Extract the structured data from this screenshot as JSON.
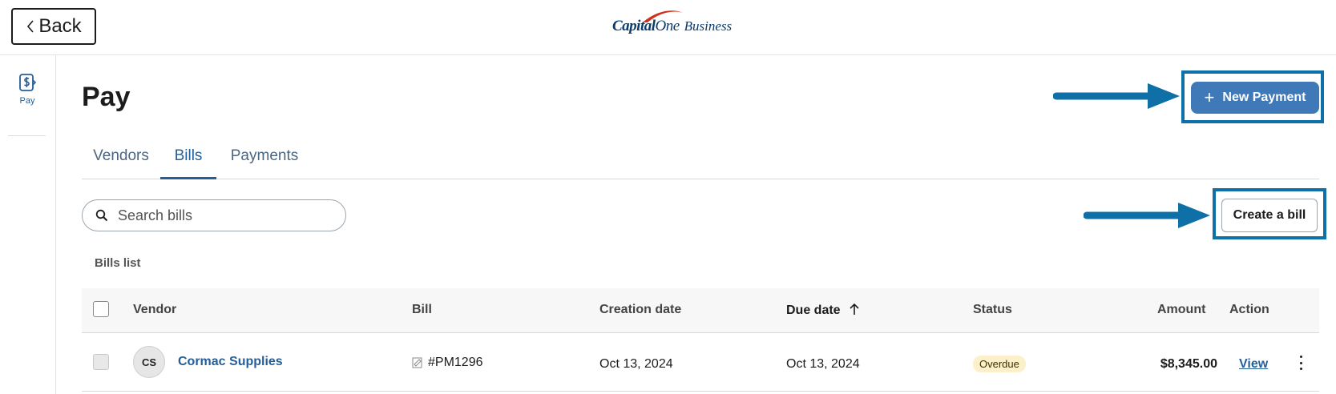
{
  "header": {
    "back_label": "Back",
    "brand_capital": "Capital",
    "brand_one": "One",
    "brand_business": "Business",
    "brand_color": "#0b3b6b",
    "swoosh_color": "#d22e1e"
  },
  "sidenav": {
    "items": [
      {
        "label": "Pay",
        "icon": "dollar-document-icon"
      }
    ]
  },
  "page": {
    "title": "Pay",
    "new_payment_label": "New Payment",
    "create_bill_label": "Create a bill",
    "accent_color": "#255f99",
    "annotation_color": "#0f70a8"
  },
  "tabs": [
    {
      "label": "Vendors",
      "active": false
    },
    {
      "label": "Bills",
      "active": true
    },
    {
      "label": "Payments",
      "active": false
    }
  ],
  "search": {
    "placeholder": "Search bills",
    "value": ""
  },
  "bills": {
    "list_label": "Bills list",
    "columns": {
      "vendor": "Vendor",
      "bill": "Bill",
      "creation_date": "Creation date",
      "due_date": "Due date",
      "status": "Status",
      "amount": "Amount",
      "action": "Action"
    },
    "sorted_column": "due_date",
    "sort_direction": "ascending",
    "rows": [
      {
        "initials": "CS",
        "vendor": "Cormac Supplies",
        "bill": "#PM1296",
        "creation_date": "Oct 13, 2024",
        "due_date": "Oct 13, 2024",
        "status": "Overdue",
        "amount": "$8,345.00",
        "action": "View"
      }
    ]
  }
}
